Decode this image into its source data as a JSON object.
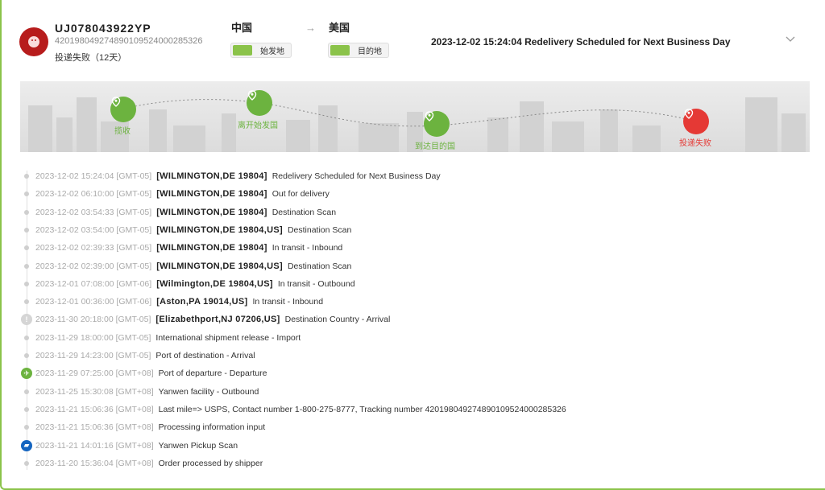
{
  "header": {
    "tracking_number": "UJ078043922YP",
    "tracking_long": "420198049274890109524000285326",
    "status": "投递失败（12天）",
    "origin_country": "中国",
    "dest_country": "美国",
    "origin_chip": "始发地",
    "dest_chip": "目的地",
    "arrow": "→",
    "latest_event": "2023-12-02 15:24:04 Redelivery Scheduled for Next Business Day"
  },
  "progress": {
    "nodes": [
      {
        "label": "揽收",
        "state": "done"
      },
      {
        "label": "离开始发国",
        "state": "done"
      },
      {
        "label": "到达目的国",
        "state": "done"
      },
      {
        "label": "投递失败",
        "state": "failed"
      }
    ]
  },
  "colors": {
    "accent": "#6cb33f",
    "fail": "#e53935",
    "info": "#1565c0"
  },
  "events": [
    {
      "time": "2023-12-02 15:24:04 [GMT-05]",
      "location": "[WILMINGTON,DE 19804]",
      "desc": "Redelivery Scheduled for Next Business Day",
      "icon": "small-dot"
    },
    {
      "time": "2023-12-02 06:10:00 [GMT-05]",
      "location": "[WILMINGTON,DE 19804]",
      "desc": "Out for delivery",
      "icon": "small-dot"
    },
    {
      "time": "2023-12-02 03:54:33 [GMT-05]",
      "location": "[WILMINGTON,DE 19804]",
      "desc": "Destination Scan",
      "icon": "small-dot"
    },
    {
      "time": "2023-12-02 03:54:00 [GMT-05]",
      "location": "[WILMINGTON,DE 19804,US]",
      "desc": "Destination Scan",
      "icon": "small-dot"
    },
    {
      "time": "2023-12-02 02:39:33 [GMT-05]",
      "location": "[WILMINGTON,DE 19804]",
      "desc": "In transit - Inbound",
      "icon": "small-dot"
    },
    {
      "time": "2023-12-02 02:39:00 [GMT-05]",
      "location": "[WILMINGTON,DE 19804,US]",
      "desc": "Destination Scan",
      "icon": "small-dot"
    },
    {
      "time": "2023-12-01 07:08:00 [GMT-06]",
      "location": "[Wilmington,DE 19804,US]",
      "desc": "In transit - Outbound",
      "icon": "small-dot"
    },
    {
      "time": "2023-12-01 00:36:00 [GMT-06]",
      "location": "[Aston,PA 19014,US]",
      "desc": "In transit - Inbound",
      "icon": "small-dot"
    },
    {
      "time": "2023-11-30 20:18:00 [GMT-05]",
      "location": "[Elizabethport,NJ 07206,US]",
      "desc": "Destination Country - Arrival",
      "icon": "alert-icon"
    },
    {
      "time": "2023-11-29 18:00:00 [GMT-05]",
      "location": "",
      "desc": "International shipment release - Import",
      "icon": "small-dot"
    },
    {
      "time": "2023-11-29 14:23:00 [GMT-05]",
      "location": "",
      "desc": "Port of destination - Arrival",
      "icon": "small-dot"
    },
    {
      "time": "2023-11-29 07:25:00 [GMT+08]",
      "location": "",
      "desc": "Port of departure - Departure",
      "icon": "plane-icon"
    },
    {
      "time": "2023-11-25 15:30:08 [GMT+08]",
      "location": "",
      "desc": "Yanwen facility - Outbound",
      "icon": "small-dot"
    },
    {
      "time": "2023-11-21 15:06:36 [GMT+08]",
      "location": "",
      "desc": "Last mile=> USPS, Contact number 1-800-275-8777, Tracking number 420198049274890109524000285326",
      "icon": "small-dot"
    },
    {
      "time": "2023-11-21 15:06:36 [GMT+08]",
      "location": "",
      "desc": "Processing information input",
      "icon": "small-dot"
    },
    {
      "time": "2023-11-21 14:01:16 [GMT+08]",
      "location": "",
      "desc": "Yanwen Pickup Scan",
      "icon": "truck-icon"
    },
    {
      "time": "2023-11-20 15:36:04 [GMT+08]",
      "location": "",
      "desc": "Order processed by shipper",
      "icon": "small-dot"
    }
  ]
}
